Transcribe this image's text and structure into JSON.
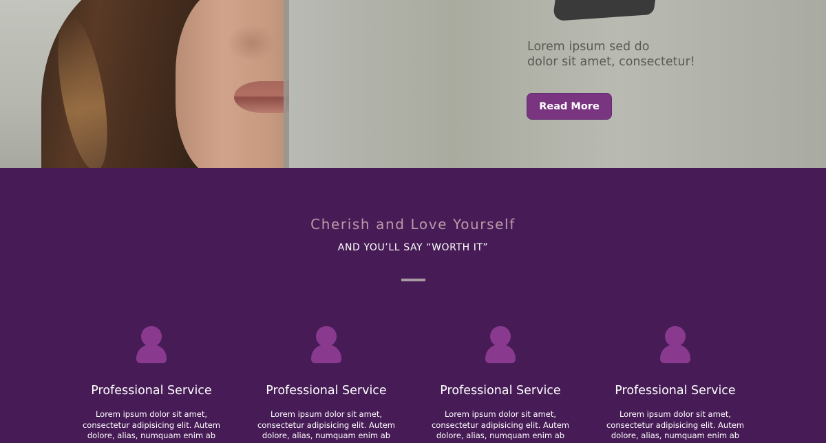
{
  "hero": {
    "text_line1": "Lorem ipsum sed do",
    "text_line2": "dolor sit amet, consectetur!",
    "button_label": "Read More"
  },
  "section": {
    "title": "Cherish and Love Yourself",
    "subtitle": "AND YOU’LL SAY “WORTH IT”"
  },
  "services": [
    {
      "title": "Professional Service",
      "text_line1": "Lorem ipsum dolor sit amet,",
      "text_line2": "consectetur adipisicing elit. Autem",
      "text_line3": "dolore, alias, numquam enim ab"
    },
    {
      "title": "Professional Service",
      "text_line1": "Lorem ipsum dolor sit amet,",
      "text_line2": "consectetur adipisicing elit. Autem",
      "text_line3": "dolore, alias, numquam enim ab"
    },
    {
      "title": "Professional Service",
      "text_line1": "Lorem ipsum dolor sit amet,",
      "text_line2": "consectetur adipisicing elit. Autem",
      "text_line3": "dolore, alias, numquam enim ab"
    },
    {
      "title": "Professional Service",
      "text_line1": "Lorem ipsum dolor sit amet,",
      "text_line2": "consectetur adipisicing elit. Autem",
      "text_line3": "dolore, alias, numquam enim ab"
    }
  ],
  "icons": {
    "service": "user-icon"
  },
  "colors": {
    "section_bg": "#471c56",
    "accent": "#7a3580",
    "icon": "#8a3a8e",
    "title_muted": "#b99aa8"
  }
}
